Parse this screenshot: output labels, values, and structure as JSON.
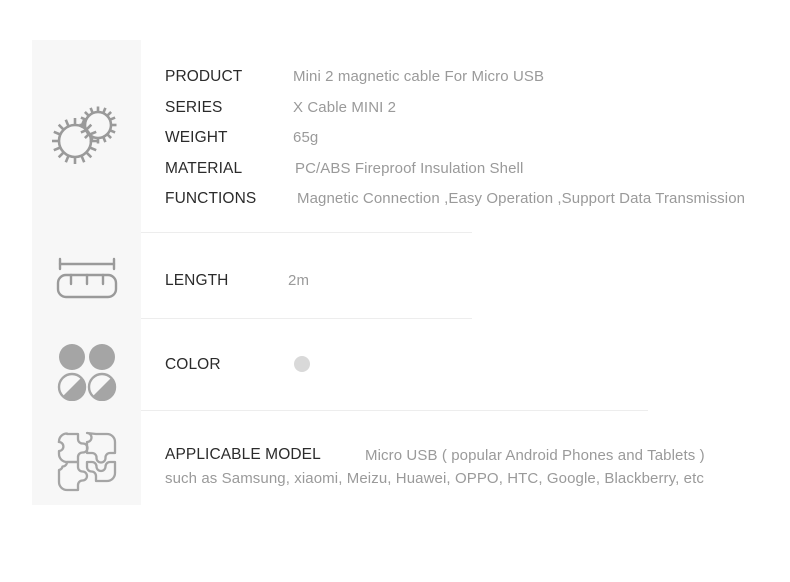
{
  "specs": {
    "main_rows": [
      {
        "label": "PRODUCT",
        "value": "Mini 2 magnetic cable For Micro USB"
      },
      {
        "label": "SERIES",
        "value": "X Cable MINI 2"
      },
      {
        "label": "WEIGHT",
        "value": "65g"
      },
      {
        "label": "MATERIAL",
        "value": "PC/ABS Fireproof Insulation Shell"
      },
      {
        "label": "FUNCTIONS",
        "value": "Magnetic Connection ,Easy Operation ,Support Data Transmission"
      }
    ],
    "length_row": {
      "label": "LENGTH",
      "value": "2m"
    },
    "color_row": {
      "label": "COLOR",
      "swatch_color": "#d9d9d9"
    },
    "applicable_row": {
      "label": "APPLICABLE MODEL",
      "value": "Micro USB ( popular Android Phones and Tablets )",
      "sub": "such as Samsung, xiaomi, Meizu, Huawei, OPPO, HTC, Google, Blackberry, etc"
    }
  },
  "icons": {
    "gears": "gears-icon",
    "ruler": "ruler-icon",
    "color_circles": "color-circles-icon",
    "puzzle": "puzzle-icon"
  },
  "theme": {
    "icon_column_bg": "#f7f7f7",
    "icon_stroke": "#9a9a9a",
    "label_color": "#2b2b2b",
    "value_color": "#9a9a9a",
    "divider_color": "#ededed"
  }
}
